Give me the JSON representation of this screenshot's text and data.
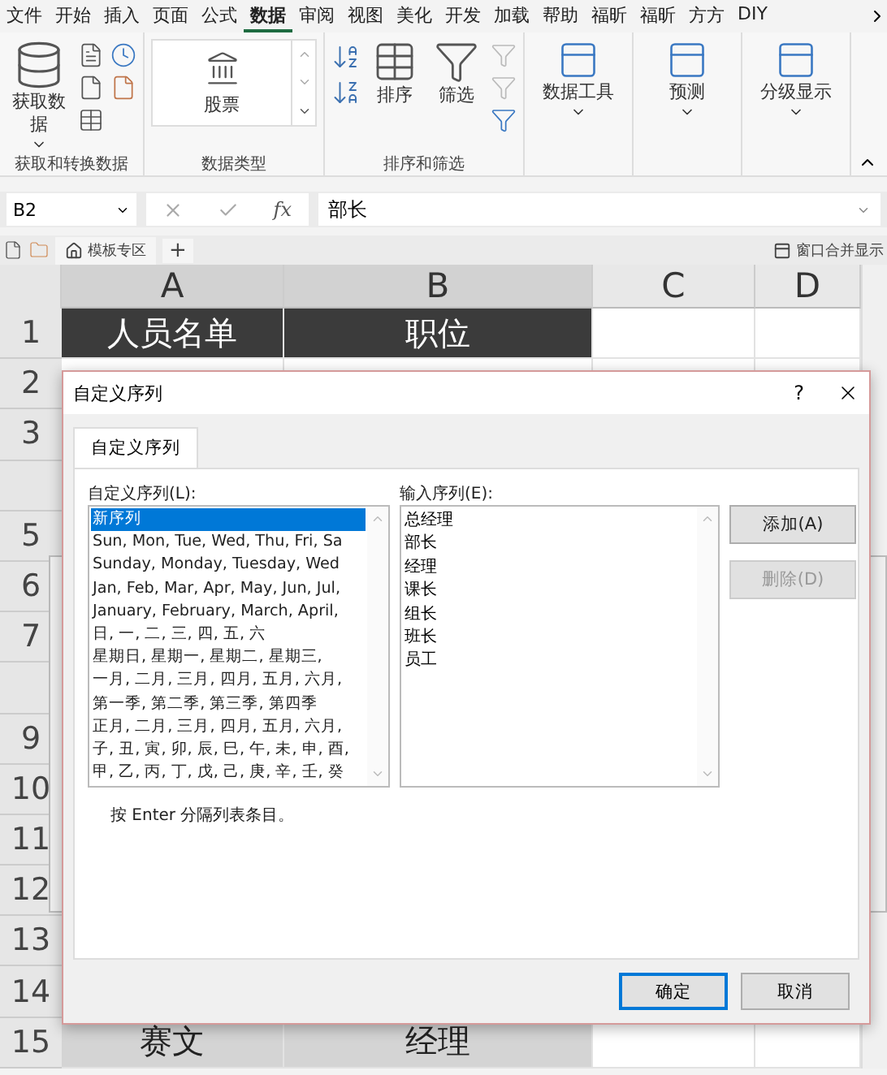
{
  "ribbon": {
    "tabs": [
      {
        "label": "文件",
        "selected": false
      },
      {
        "label": "开始",
        "selected": false
      },
      {
        "label": "插入",
        "selected": false
      },
      {
        "label": "页面",
        "selected": false
      },
      {
        "label": "公式",
        "selected": false
      },
      {
        "label": "数据",
        "selected": true
      },
      {
        "label": "审阅",
        "selected": false
      },
      {
        "label": "视图",
        "selected": false
      },
      {
        "label": "美化",
        "selected": false
      },
      {
        "label": "开发",
        "selected": false
      },
      {
        "label": "加载",
        "selected": false
      },
      {
        "label": "帮助",
        "selected": false
      },
      {
        "label": "福昕",
        "selected": false
      },
      {
        "label": "福昕",
        "selected": false
      },
      {
        "label": "方方",
        "selected": false
      },
      {
        "label": "DIY",
        "selected": false
      }
    ],
    "groups": [
      {
        "kind": "get-data",
        "label": "获取和转换数据",
        "buttons": [
          "获取数据"
        ]
      },
      {
        "kind": "data-types",
        "label": "数据类型",
        "buttons": [
          "股票"
        ]
      },
      {
        "kind": "sort-filter",
        "label": "排序和筛选",
        "buttons": [
          "排序",
          "筛选"
        ]
      },
      {
        "kind": "tool",
        "buttons": [
          "数据工具"
        ]
      },
      {
        "kind": "tool",
        "buttons": [
          "预测"
        ]
      },
      {
        "kind": "tool",
        "buttons": [
          "分级显示"
        ]
      }
    ]
  },
  "formula_bar": {
    "name_box": "B2",
    "function_label": "fx",
    "value": "部长"
  },
  "sheet_tabs": {
    "tabs": [
      "模板专区"
    ],
    "add": "+",
    "window_merge": "窗口合并显示"
  },
  "grid": {
    "columns": [
      {
        "label": "A",
        "selected": true
      },
      {
        "label": "B",
        "selected": true
      },
      {
        "label": "C",
        "selected": false
      },
      {
        "label": "D",
        "selected": false
      }
    ],
    "rows": [
      {
        "number": "1",
        "kind": "header",
        "cells": [
          "人员名单",
          "职位"
        ]
      },
      {
        "number": "2"
      },
      {
        "number": "3"
      },
      {},
      {
        "number": "5"
      },
      {
        "number": "6"
      },
      {
        "number": "7"
      },
      {},
      {
        "number": "9"
      },
      {
        "number": "10"
      },
      {
        "number": "11"
      },
      {
        "number": "12"
      },
      {
        "number": "13"
      },
      {
        "number": "14"
      },
      {
        "number": "15",
        "kind": "selected",
        "cells": [
          "赛文",
          "经理"
        ]
      }
    ]
  },
  "dialog": {
    "title": "自定义序列",
    "help": "?",
    "tabs": [
      {
        "label": "自定义序列",
        "selected": true
      }
    ],
    "list_label": "自定义序列(L):",
    "list_items": [
      {
        "text": "新序列",
        "selected": true
      },
      {
        "text": "Sun, Mon, Tue, Wed, Thu, Fri, Sa",
        "selected": false
      },
      {
        "text": "Sunday, Monday, Tuesday, Wed",
        "selected": false
      },
      {
        "text": "Jan, Feb, Mar, Apr, May, Jun, Jul,",
        "selected": false
      },
      {
        "text": "January, February, March, April,",
        "selected": false
      },
      {
        "text": "日, 一, 二, 三, 四, 五, 六",
        "selected": false
      },
      {
        "text": "星期日, 星期一, 星期二, 星期三,",
        "selected": false
      },
      {
        "text": "一月, 二月, 三月, 四月, 五月, 六月,",
        "selected": false
      },
      {
        "text": "第一季, 第二季, 第三季, 第四季",
        "selected": false
      },
      {
        "text": "正月, 二月, 三月, 四月, 五月, 六月,",
        "selected": false
      },
      {
        "text": "子, 丑, 寅, 卯, 辰, 巳, 午, 未, 申, 酉,",
        "selected": false
      },
      {
        "text": "甲, 乙, 丙, 丁, 戊, 己, 庚, 辛, 壬, 癸",
        "selected": false
      }
    ],
    "input_label": "输入序列(E):",
    "input_lines": [
      "总经理",
      "部长",
      "经理",
      "课长",
      "组长",
      "班长",
      "员工"
    ],
    "side_buttons": [
      {
        "label": "添加(A)",
        "disabled": false
      },
      {
        "label": "删除(D)",
        "disabled": true
      }
    ],
    "hint": "按 Enter 分隔列表条目。",
    "buttons": [
      {
        "label": "确定",
        "default": true
      },
      {
        "label": "取消",
        "default": false
      }
    ]
  }
}
